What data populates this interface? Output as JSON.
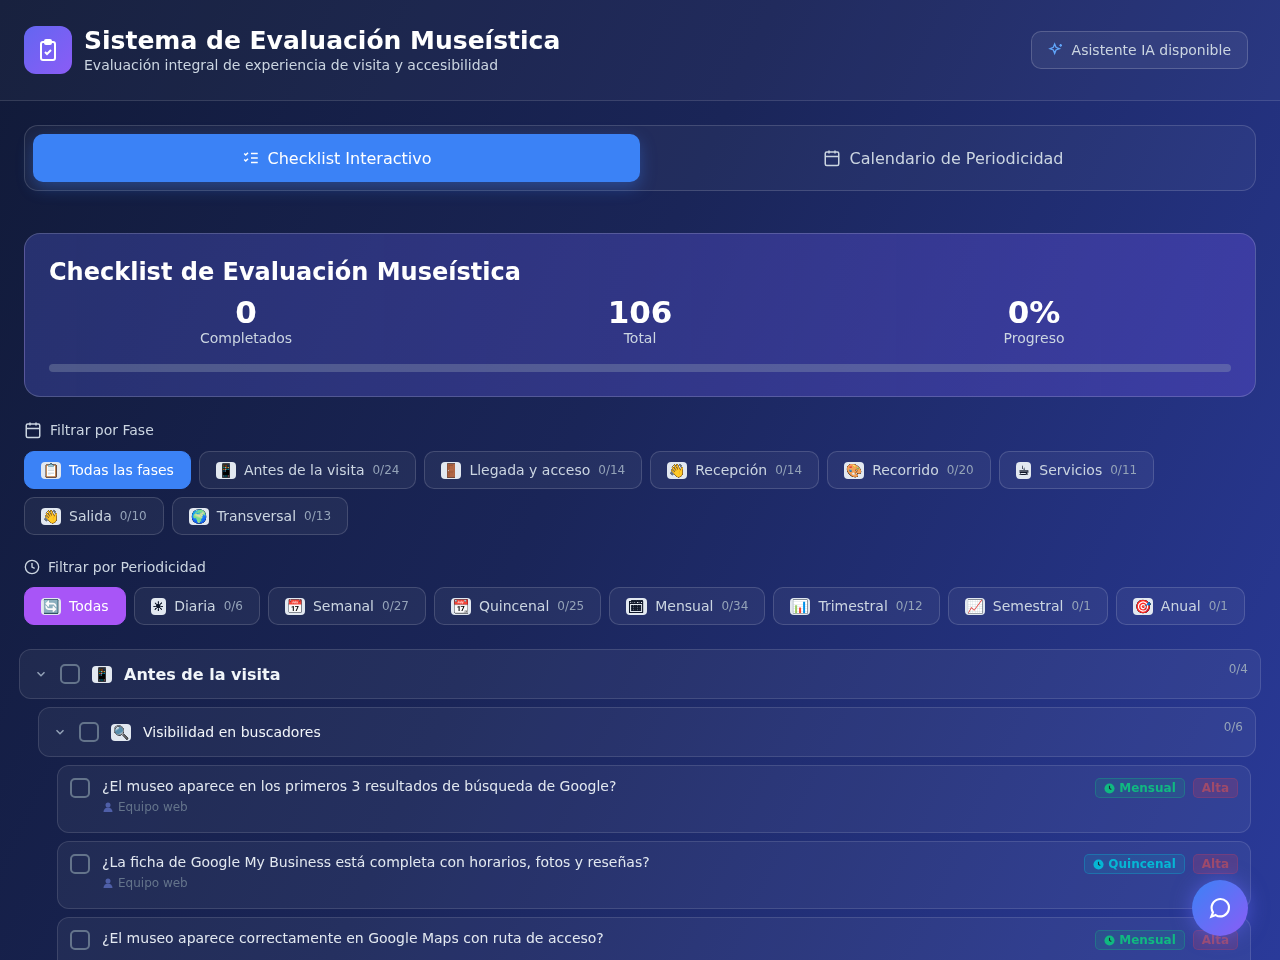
{
  "header": {
    "title": "Sistema de Evaluación Museística",
    "subtitle": "Evaluación integral de experiencia de visita y accesibilidad",
    "assistant_badge": "Asistente IA disponible"
  },
  "tabs": [
    {
      "label": "Checklist Interactivo",
      "kind": "checklist",
      "selected": true
    },
    {
      "label": "Calendario de Periodicidad",
      "kind": "calendar",
      "selected": false
    }
  ],
  "summary": {
    "title": "Checklist de Evaluación Museística",
    "stats": [
      {
        "value": "0",
        "label": "Completados"
      },
      {
        "value": "106",
        "label": "Total"
      },
      {
        "value": "0%",
        "label": "Progreso"
      }
    ],
    "level": 0
  },
  "phase_filter": {
    "label": "Filtrar por Fase",
    "options": [
      {
        "emoji": "📋",
        "label": "Todas las fases",
        "selected": true
      },
      {
        "emoji": "📱",
        "label": "Antes de la visita",
        "count": "0/24",
        "selected": false
      },
      {
        "emoji": "🚪",
        "label": "Llegada y acceso",
        "count": "0/14",
        "selected": false
      },
      {
        "emoji": "👋",
        "label": "Recepción",
        "count": "0/14",
        "selected": false
      },
      {
        "emoji": "🎨",
        "label": "Recorrido",
        "count": "0/20",
        "selected": false
      },
      {
        "emoji": "☕",
        "label": "Servicios",
        "count": "0/11",
        "selected": false
      },
      {
        "emoji": "👋",
        "label": "Salida",
        "count": "0/10",
        "selected": false
      },
      {
        "emoji": "🌍",
        "label": "Transversal",
        "count": "0/13",
        "selected": false
      }
    ]
  },
  "period_filter": {
    "label": "Filtrar por Periodicidad",
    "options": [
      {
        "emoji": "🔄",
        "label": "Todas",
        "selected": true
      },
      {
        "emoji": "☀",
        "label": "Diaria",
        "count": "0/6",
        "selected": false
      },
      {
        "emoji": "📅",
        "label": "Semanal",
        "count": "0/27",
        "selected": false
      },
      {
        "emoji": "📆",
        "label": "Quincenal",
        "count": "0/25",
        "selected": false
      },
      {
        "emoji": "🗓",
        "label": "Mensual",
        "count": "0/34",
        "selected": false
      },
      {
        "emoji": "📊",
        "label": "Trimestral",
        "count": "0/12",
        "selected": false
      },
      {
        "emoji": "📈",
        "label": "Semestral",
        "count": "0/1",
        "selected": false
      },
      {
        "emoji": "🎯",
        "label": "Anual",
        "count": "0/1",
        "selected": false
      }
    ]
  },
  "sections": [
    {
      "emoji": "📱",
      "title": "Antes de la visita",
      "count": "0/4",
      "expanded": true,
      "checked": false,
      "groups": [
        {
          "emoji": "🔍",
          "title": "Visibilidad en buscadores",
          "count": "0/6",
          "expanded": true,
          "checked": false,
          "items": [
            {
              "question": "¿El museo aparece en los primeros 3 resultados de búsqueda de Google?",
              "owner": "Equipo web",
              "period": "Mensual",
              "color": "#10b981",
              "priority": "Alta",
              "checked": false
            },
            {
              "question": "¿La ficha de Google My Business está completa con horarios, fotos y reseñas?",
              "owner": "Equipo web",
              "period": "Quincenal",
              "color": "#06b6d4",
              "priority": "Alta",
              "checked": false
            },
            {
              "question": "¿El museo aparece correctamente en Google Maps con ruta de acceso?",
              "period": "Mensual",
              "color": "#10b981",
              "priority": "Alta",
              "checked": false
            }
          ]
        }
      ]
    }
  ]
}
